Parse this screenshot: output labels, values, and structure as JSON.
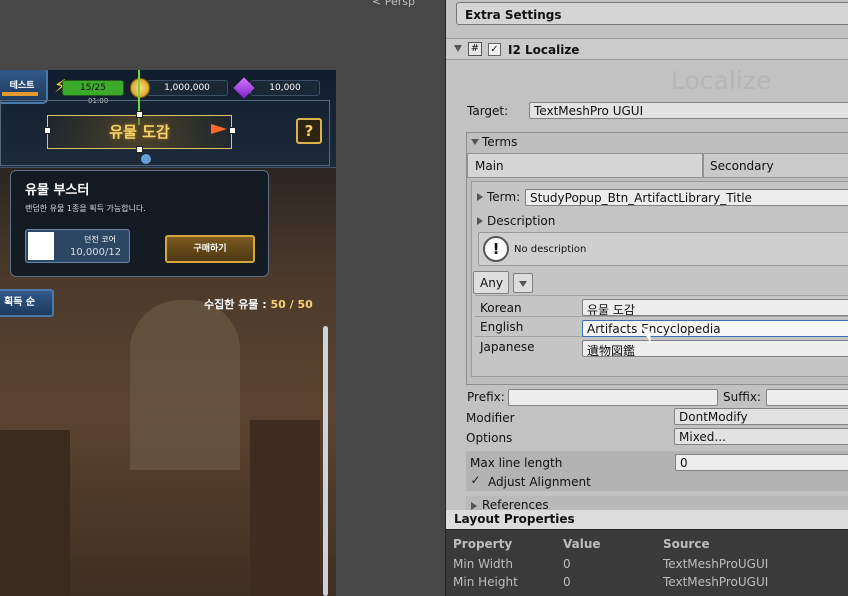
{
  "scene": {
    "persp_label": "< Persp",
    "game": {
      "test_button": "테스트",
      "stamina": "15/25",
      "stamina_timer": "01:00",
      "gold": "1,000,000",
      "gems": "10,000",
      "title": "유물 도감",
      "help_button": "?",
      "booster_title": "유물 부스터",
      "booster_desc": "랜덤한 유물 1종을 획득 가능합니다.",
      "core_label": "던전 코어",
      "core_value": "10,000/12",
      "buy_button": "구매하기",
      "sort_button": "획득 순",
      "collected_label": "수집한 유물 : ",
      "collected_value": "50 / 50"
    }
  },
  "inspector": {
    "extra_settings": "Extra Settings",
    "component_title": "I2 Localize",
    "watermark": "Localize",
    "target_label": "Target:",
    "target_value": "TextMeshPro UGUI",
    "terms_label": "Terms",
    "tab_main": "Main",
    "tab_secondary": "Secondary",
    "term_label": "Term:",
    "term_value": "StudyPopup_Btn_ArtifactLibrary_Title",
    "description_label": "Description",
    "no_description": "No description",
    "any_label": "Any",
    "languages": [
      {
        "name": "Korean",
        "value": "유물 도감"
      },
      {
        "name": "English",
        "value": "Artifacts Encyclopedia"
      },
      {
        "name": "Japanese",
        "value": "遺物図鑑"
      }
    ],
    "prefix_label": "Prefix:",
    "suffix_label": "Suffix:",
    "modifier_label": "Modifier",
    "modifier_value": "DontModify",
    "options_label": "Options",
    "options_value": "Mixed...",
    "max_line_label": "Max line length",
    "max_line_value": "0",
    "adjust_alignment": "Adjust Alignment",
    "references": "References"
  },
  "layout_properties": {
    "title": "Layout Properties",
    "headers": [
      "Property",
      "Value",
      "Source"
    ],
    "rows": [
      [
        "Min Width",
        "0",
        "TextMeshProUGUI"
      ],
      [
        "Min Height",
        "0",
        "TextMeshProUGUI"
      ]
    ]
  }
}
